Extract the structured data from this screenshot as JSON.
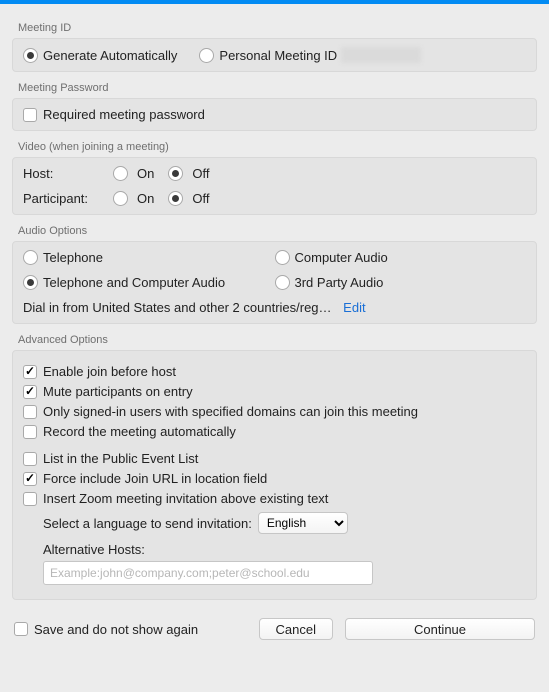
{
  "sections": {
    "meeting_id": {
      "label": "Meeting ID",
      "generate": "Generate Automatically",
      "personal": "Personal Meeting ID"
    },
    "meeting_password": {
      "label": "Meeting Password",
      "required": "Required meeting password"
    },
    "video": {
      "label": "Video (when joining a meeting)",
      "host": "Host:",
      "participant": "Participant:",
      "on": "On",
      "off": "Off"
    },
    "audio": {
      "label": "Audio Options",
      "telephone": "Telephone",
      "computer": "Computer Audio",
      "both": "Telephone and Computer Audio",
      "third": "3rd Party Audio",
      "dial": "Dial in from United States and other 2 countries/reg…",
      "edit": "Edit"
    },
    "advanced": {
      "label": "Advanced Options",
      "join_before": "Enable join before host",
      "mute_entry": "Mute participants on entry",
      "signed_domains": "Only signed-in users with specified domains can join this meeting",
      "record_auto": "Record the meeting automatically",
      "public_list": "List in the Public Event List",
      "force_url": "Force include Join URL in location field",
      "insert_invite": "Insert Zoom meeting invitation above existing text",
      "select_lang": "Select a language to send invitation:",
      "lang_value": "English",
      "alt_hosts": "Alternative Hosts:",
      "alt_placeholder": "Example:john@company.com;peter@school.edu"
    }
  },
  "bottom": {
    "save": "Save and do not show again",
    "cancel": "Cancel",
    "continue": "Continue"
  }
}
